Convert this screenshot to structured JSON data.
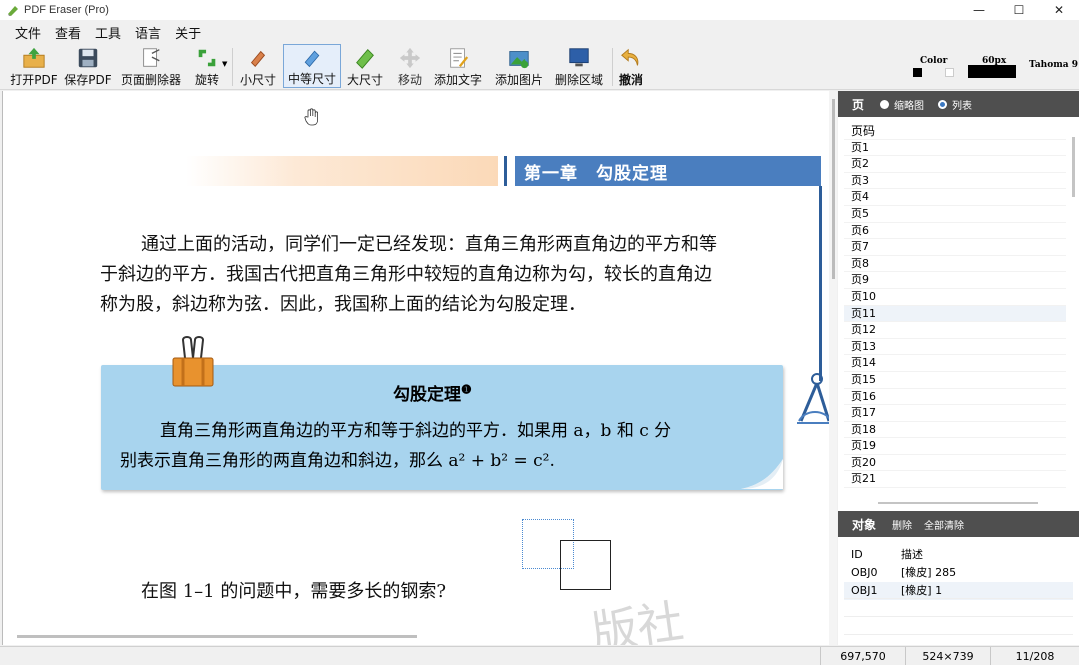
{
  "window": {
    "title": "PDF Eraser (Pro)",
    "minimize": "—",
    "maximize": "☐",
    "close": "✕"
  },
  "menu": [
    "文件",
    "查看",
    "工具",
    "语言",
    "关于"
  ],
  "toolbar": {
    "open": "打开PDF",
    "save": "保存PDF",
    "page_remover": "页面删除器",
    "rotate": "旋转",
    "small": "小尺寸",
    "medium": "中等尺寸",
    "large": "大尺寸",
    "move": "移动",
    "add_text": "添加文字",
    "add_image": "添加图片",
    "delete_area": "删除区域",
    "undo": "撤消",
    "color_label": "Color",
    "size_label": "60px",
    "font_label": "Tahoma 9"
  },
  "document": {
    "chapter_title": "第一章　勾股定理",
    "para_line1": "通过上面的活动，同学们一定已经发现：直角三角形两直角边的平方和等",
    "para_line2": "于斜边的平方．我国古代把直角三角形中较短的直角边称为勾，较长的直角边",
    "para_line3": "称为股，斜边称为弦．因此，我国称上面的结论为勾股定理．",
    "theorem_title": "勾股定理",
    "theorem_note": "❶",
    "theorem_line1": "直角三角形两直角边的平方和等于斜边的平方．如果用 a，b 和 c 分",
    "theorem_line2": "别表示直角三角形的两直角边和斜边，那么 a² + b² = c².",
    "question": "在图 1–1 的问题中，需要多长的钢索?",
    "watermark": "版社"
  },
  "pages_panel": {
    "header": "页",
    "thumb_option": "缩略图",
    "list_option": "列表",
    "column": "页码",
    "pages": [
      "页1",
      "页2",
      "页3",
      "页4",
      "页5",
      "页6",
      "页7",
      "页8",
      "页9",
      "页10",
      "页11",
      "页12",
      "页13",
      "页14",
      "页15",
      "页16",
      "页17",
      "页18",
      "页19",
      "页20",
      "页21"
    ]
  },
  "objects_panel": {
    "header": "对象",
    "delete": "删除",
    "clear_all": "全部清除",
    "col_id": "ID",
    "col_desc": "描述",
    "rows": [
      {
        "id": "OBJ0",
        "desc": "[橡皮] 285"
      },
      {
        "id": "OBJ1",
        "desc": "[橡皮] 1"
      }
    ]
  },
  "status": {
    "coords": "697,570",
    "size": "524×739",
    "page": "11/208"
  },
  "colors": {
    "accent": "#4a7ebf",
    "theorem_bg": "#a8d4ee",
    "panel_header": "#4f4f4f"
  }
}
